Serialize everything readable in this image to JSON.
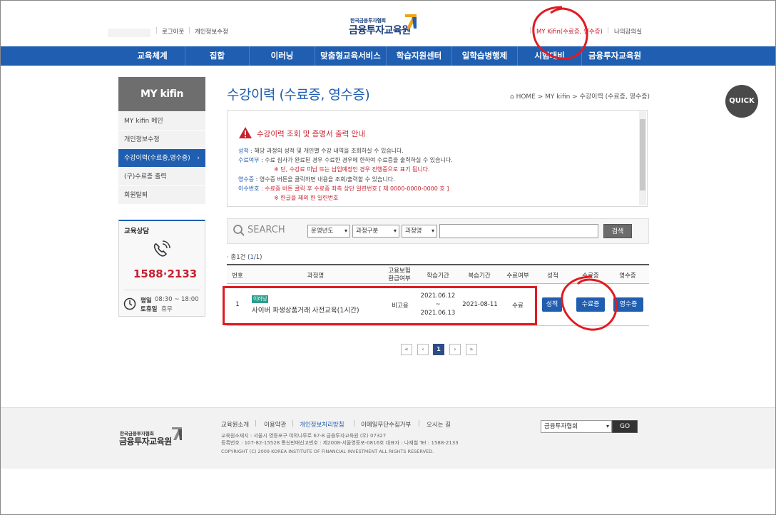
{
  "header": {
    "logout": "로그아웃",
    "edit_profile": "개인정보수정",
    "logo_small": "한국금융투자협회",
    "logo_main": "금융투자교육원",
    "my_kifin": "MY Kifin(수료증, 영수증)",
    "my_lecture": "나의강의실"
  },
  "nav": [
    "교육체계",
    "집합",
    "이러닝",
    "맞춤형교육서비스",
    "학습지원센터",
    "일학습병행제",
    "시험대비",
    "금융투자교육원"
  ],
  "sidebar": {
    "title": "MY kifin",
    "items": [
      {
        "label": "MY kifin 메인"
      },
      {
        "label": "개인정보수정"
      },
      {
        "label": "수강이력(수료증,영수증)"
      },
      {
        "label": "(구)수료증 출력"
      },
      {
        "label": "회원탈퇴"
      }
    ],
    "consult_title": "교육상담",
    "phone": "1588·2133",
    "hours_weekday_label": "평일",
    "hours_weekday": "08:30 ~ 18:00",
    "hours_sat_label": "토휴일",
    "hours_sat": "휴무"
  },
  "main": {
    "title": "수강이력 (수료증, 영수증)",
    "breadcrumb": "⌂ HOME  >  MY kifin  >  수강이력 (수료증, 영수증)"
  },
  "notice": {
    "title": "수강이력 조회 및 증명서 출력 안내",
    "lines": [
      {
        "key": "성적",
        "text": " : 해당 과정의 성적 및 개인별 수강 내역을 조회하실 수 있습니다."
      },
      {
        "key": "수료여부",
        "text": " : 수료 심사가 완료된 경우 수료한 경우에 한하여 수료증을 출력하실 수 있습니다."
      },
      {
        "key": "",
        "text": "※ 단, 수강료 미납 또는 납입예정인 경우 진행중으로 표기 됩니다."
      },
      {
        "key": "영수증",
        "text": " : 영수증 버튼을 클릭하면 내용을 조회/출력할 수 있습니다."
      },
      {
        "key": "이수번호",
        "text": " : 수료증 버튼 클릭 후 수료증 좌측 상단 일련번호 [ 제 0000-0000-0000 호 ]"
      },
      {
        "key": "",
        "text": "※ 한글을 제외 한 일련번호"
      }
    ]
  },
  "quick": "QUICK",
  "search": {
    "label": "SEARCH",
    "year": "운영년도",
    "category": "과정구분",
    "course": "과정명",
    "query": "",
    "button": "검색"
  },
  "result_count_prefix": "· 총1건 (",
  "result_count_page": "1",
  "result_count_suffix": "/1)",
  "table": {
    "headers": [
      "번호",
      "과정명",
      "고용보험\n환급여부",
      "학습기간",
      "복습기간",
      "수료여부",
      "성적",
      "수료증",
      "영수증"
    ],
    "rows": [
      {
        "no": "1",
        "badge": "이러닝",
        "course": "사이버 파생상품거래 사전교육(1시간)",
        "refund": "비고용",
        "period_start": "2021.06.12",
        "period_sep": "~",
        "period_end": "2021.06.13",
        "review": "2021-08-11",
        "status": "수료",
        "grade_btn": "성적",
        "cert_btn": "수료증",
        "receipt_btn": "영수증"
      }
    ]
  },
  "pager": {
    "first": "«",
    "prev": "‹",
    "current": "1",
    "next": "›",
    "last": "»"
  },
  "footer": {
    "links": [
      "교육원소개",
      "이용약관",
      "개인정보처리방침",
      "이메일무단수집거부",
      "오시는 길"
    ],
    "address": "교육원소재지 : 서울시 영등포구 여의나루로 67-8 금융투자교육원 (우) 07327",
    "registration": "등록번호 : 107-82-15528 통신판매신고번호 : 제2008-서울영등포-0816호 대표자 : 나재철 Tel : 1588-2133",
    "copyright": "COPYRIGHT (C) 2009 KOREA INSTITUTE OF FINANCIAL INVESTMENT ALL RIGHTS RESERVED.",
    "logo_small": "한국금융투자협회",
    "logo_main": "금융투자교육원",
    "family_site": "금융투자협회",
    "go": "GO"
  },
  "colors": {
    "primary": "#1f5eb0",
    "annotation": "#e01b22",
    "badge": "#2c9e8c"
  }
}
